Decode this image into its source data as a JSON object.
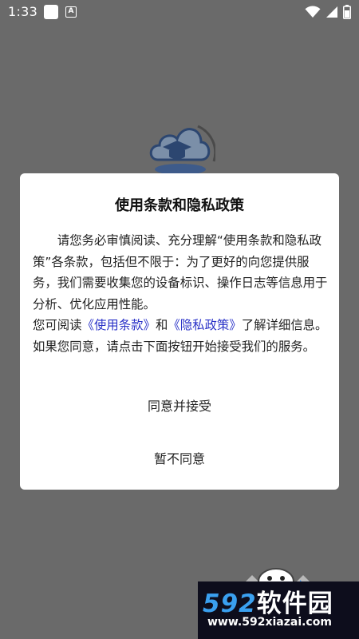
{
  "status_bar": {
    "time": "1:33",
    "a_badge": "A"
  },
  "dialog": {
    "title": "使用条款和隐私政策",
    "paragraph1": "请您务必审慎阅读、充分理解“使用条款和隐私政策”各条款，包括但不限于：为了更好的向您提供服务，我们需要收集您的设备标识、操作日志等信息用于分析、优化应用性能。",
    "p2_prefix": "您可阅读",
    "terms_link": "《使用条款》",
    "p2_and": "和",
    "privacy_link": "《隐私政策》",
    "p2_suffix": "了解详细信息。如果您同意，请点击下面按钮开始接受我们的服务。",
    "accept_button": "同意并接受",
    "decline_button": "暂不同意"
  },
  "watermark": {
    "number": "592",
    "name": "软件园",
    "url": "www.592xiazai.com"
  },
  "colors": {
    "overlay": "#6a6a6a",
    "link": "#2b33c8",
    "watermark_blue": "#3aa0f0"
  }
}
